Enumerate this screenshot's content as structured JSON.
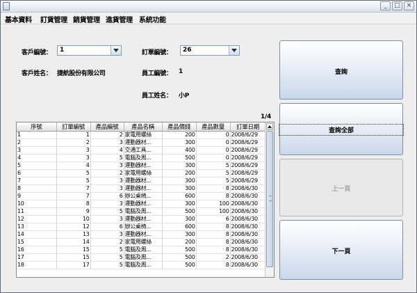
{
  "menu": [
    "基本資料",
    "訂貨管理",
    "銷貨管理",
    "進貨管理",
    "系統功能"
  ],
  "window_buttons": {
    "minimize": "_",
    "maximize": "□",
    "close": "×"
  },
  "form": {
    "customer_id_label": "客戶編號：",
    "customer_id_value": "1",
    "order_id_label": "訂單編號：",
    "order_id_value": "26",
    "customer_name_label": "客戶姓名：",
    "customer_name_value": "捷航股份有限公司",
    "employee_id_label": "員工編號：",
    "employee_id_value": "1",
    "employee_name_label": "員工姓名：",
    "employee_name_value": "小P"
  },
  "page_indicator": "1/4",
  "buttons": {
    "query": "查詢",
    "query_all": "查詢全部",
    "prev_page": "上一頁",
    "next_page": "下一頁"
  },
  "table": {
    "headers": [
      "序號",
      "訂單編號",
      "產品編號",
      "產品名稱",
      "產品價錢",
      "產品數量",
      "訂單日期"
    ],
    "rows": [
      [
        "1",
        "1",
        "2",
        "家電用螺絲",
        "200",
        "0",
        "2008/6/29"
      ],
      [
        "2",
        "2",
        "3",
        "運動器材...",
        "300",
        "0",
        "2008/6/29"
      ],
      [
        "3",
        "3",
        "4",
        "交通工具...",
        "400",
        "0",
        "2008/6/29"
      ],
      [
        "4",
        "3",
        "5",
        "電腦及周...",
        "500",
        "0",
        "2008/6/29"
      ],
      [
        "5",
        "4",
        "3",
        "運動器材...",
        "300",
        "5",
        "2008/6/29"
      ],
      [
        "6",
        "5",
        "2",
        "家電用螺絲",
        "200",
        "5",
        "2008/6/29"
      ],
      [
        "7",
        "5",
        "3",
        "運動器材...",
        "300",
        "5",
        "2008/6/29"
      ],
      [
        "8",
        "7",
        "3",
        "運動器材...",
        "300",
        "8",
        "2008/6/30"
      ],
      [
        "9",
        "7",
        "6",
        "辦公桌椅...",
        "600",
        "8",
        "2008/6/30"
      ],
      [
        "10",
        "8",
        "3",
        "運動器材...",
        "300",
        "100",
        "2008/6/30"
      ],
      [
        "11",
        "9",
        "5",
        "電腦及周...",
        "500",
        "100",
        "2008/6/30"
      ],
      [
        "12",
        "10",
        "3",
        "運動器材...",
        "300",
        "6",
        "2008/6/30"
      ],
      [
        "13",
        "12",
        "6",
        "辦公桌椅...",
        "600",
        "8",
        "2008/6/30"
      ],
      [
        "14",
        "13",
        "3",
        "運動器材...",
        "300",
        "8",
        "2008/6/30"
      ],
      [
        "15",
        "14",
        "2",
        "家電用螺絲",
        "200",
        "8",
        "2008/6/30"
      ],
      [
        "16",
        "15",
        "5",
        "電腦及周...",
        "500",
        "8",
        "2008/6/30"
      ],
      [
        "17",
        "15",
        "5",
        "電腦及周...",
        "500",
        "2",
        "2008/6/30"
      ],
      [
        "18",
        "17",
        "5",
        "電腦及周...",
        "500",
        "8",
        "2008/6/30"
      ]
    ]
  }
}
